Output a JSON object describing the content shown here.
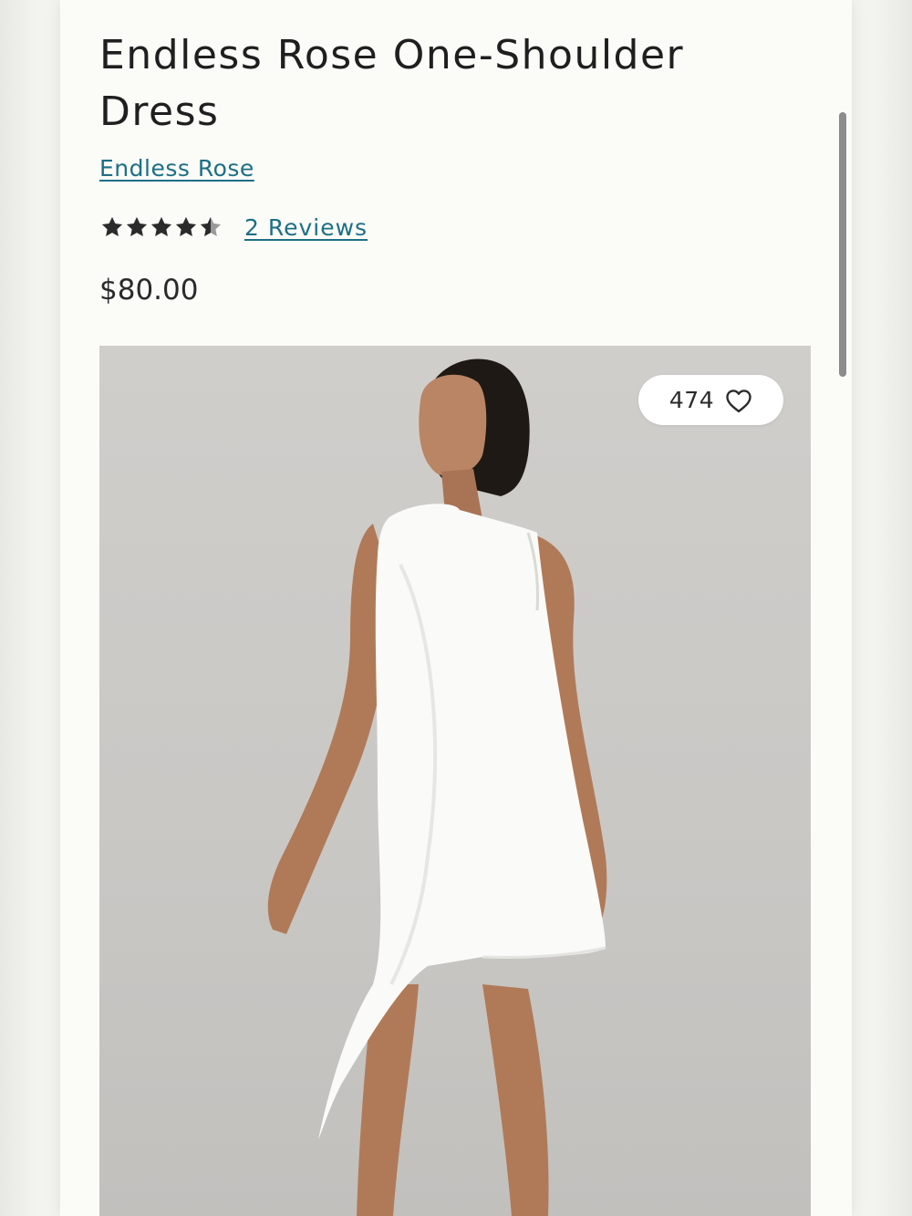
{
  "product": {
    "title": "Endless Rose One-Shoulder Dress",
    "brand": "Endless Rose",
    "rating": 4.5,
    "rating_max": 5,
    "reviews_label": "2 Reviews",
    "price": "$80.00"
  },
  "image": {
    "likes_count": "474"
  },
  "icons": {
    "star": "star-icon",
    "heart": "heart-outline-icon"
  },
  "colors": {
    "link": "#1d6f86",
    "text": "#1f1f1f",
    "star": "#2b2b2b",
    "card": "#fbfbf7"
  },
  "scroll": {
    "position": 0.12
  }
}
